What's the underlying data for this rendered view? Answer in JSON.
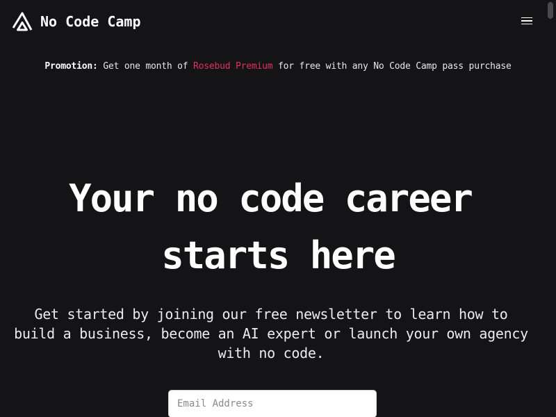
{
  "header": {
    "brand": "No Code Camp",
    "logo_icon": "triangle-logo-icon",
    "menu_icon": "hamburger-menu-icon"
  },
  "promo": {
    "label": "Promotion:",
    "text_before": " Get one month of ",
    "highlight": "Rosebud Premium",
    "text_after": " for free with any No Code Camp pass purchase",
    "highlight_color": "#e0325f"
  },
  "hero": {
    "title_line1": "Your no code career",
    "title_line2": "starts here",
    "subtitle": "Get started by joining our free newsletter to learn how to build a business, become an AI expert or launch your own agency with no code."
  },
  "signup": {
    "email_placeholder": "Email Address",
    "email_value": ""
  },
  "colors": {
    "background": "#141416",
    "text": "#ffffff",
    "accent": "#e0325f"
  }
}
